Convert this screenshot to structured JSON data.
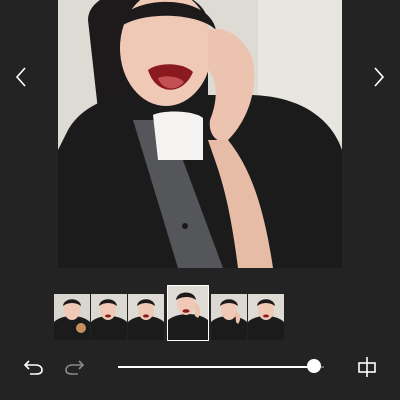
{
  "viewer": {
    "prev_icon": "chevron-left-icon",
    "next_icon": "chevron-right-icon"
  },
  "filmstrip": {
    "frame_count": 6,
    "selected_index": 3
  },
  "toolbar": {
    "undo_icon": "undo-icon",
    "redo_icon": "redo-icon",
    "slider_value": 0.95,
    "crop_icon": "crop-icon"
  },
  "colors": {
    "background": "#232323",
    "foreground": "#ffffff",
    "disabled": "#8a8a8a"
  }
}
